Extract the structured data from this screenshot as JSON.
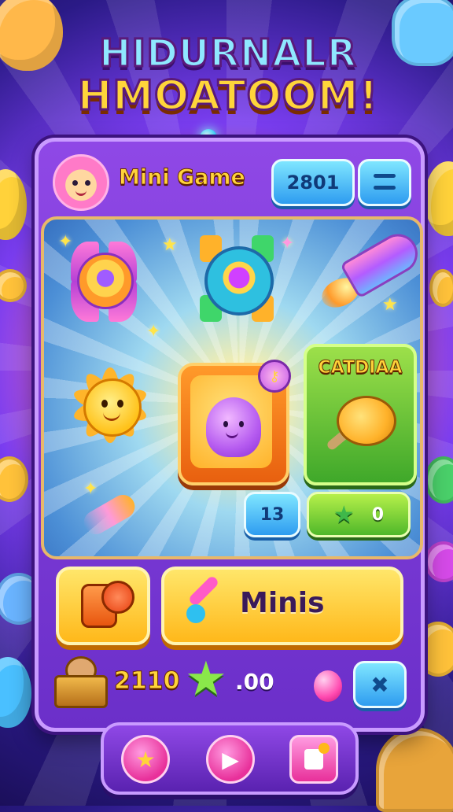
{
  "header": {
    "title_line1": "HIDURNALR",
    "title_line2": "HMOATOOM!",
    "game_name": "Mini Game",
    "score": "2801"
  },
  "board": {
    "card_title": "CATDIAA",
    "level_pill": "13",
    "green_pill_value": "0"
  },
  "actions": {
    "minis_label": "Minis"
  },
  "stats": {
    "coins": "2110",
    "stars": ".00",
    "fix_symbol": "✖"
  },
  "nav": {
    "star_glyph": "★",
    "play_glyph": "▶"
  },
  "icons": [
    "avatar-icon",
    "menu-icon",
    "rocket-gem-icon",
    "ufo-gem-icon",
    "rocket-icon",
    "sun-icon",
    "blob-icon",
    "key-icon",
    "fish-icon",
    "glove-icon",
    "paint-icon",
    "chest-icon",
    "star-icon",
    "pink-gem-icon",
    "tool-icon",
    "doc-icon"
  ],
  "colors": {
    "accent_yellow": "#ffd43a",
    "panel_purple": "#7a3df0",
    "button_blue": "#2e9cf0",
    "button_green": "#4fb82a",
    "nav_pink": "#e8309a"
  }
}
